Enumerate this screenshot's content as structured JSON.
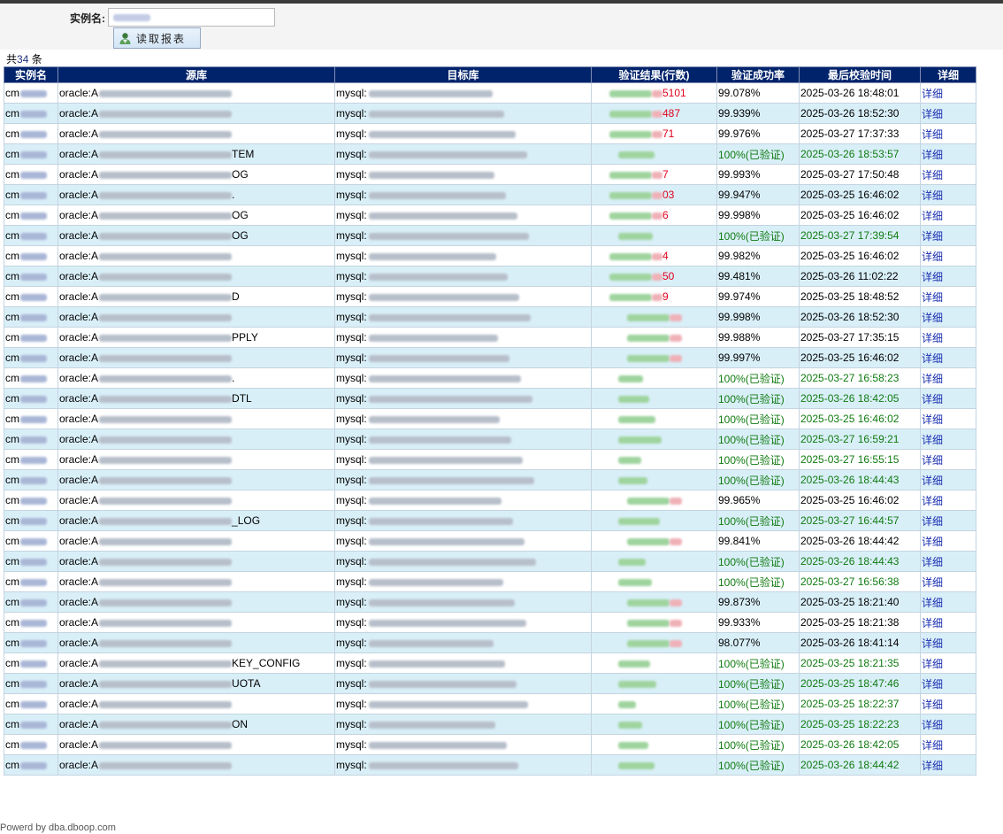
{
  "form": {
    "label": "实例名:",
    "input_value": "cmrkuar",
    "read_button": "读取报表"
  },
  "summary": {
    "prefix": "共",
    "count": "34",
    "suffix": " 条"
  },
  "table": {
    "headers": [
      "实例名",
      "源库",
      "目标库",
      "验证结果(行数)",
      "验证成功率",
      "最后校验时间",
      "详细"
    ],
    "rows": [
      {
        "inst": "cm",
        "src_pre": "oracle:A",
        "src_suf": "",
        "dst": "mysql:",
        "result_suf": "5101",
        "rate": "99.078%",
        "time": "2025-03-26 18:48:01",
        "ok": false
      },
      {
        "inst": "cm",
        "src_pre": "oracle:A",
        "src_suf": "",
        "dst": "mysql:",
        "result_suf": "487",
        "rate": "99.939%",
        "time": "2025-03-26 18:52:30",
        "ok": false
      },
      {
        "inst": "cm",
        "src_pre": "oracle:A",
        "src_suf": "",
        "dst": "mysql:",
        "result_suf": "71",
        "rate": "99.976%",
        "time": "2025-03-27 17:37:33",
        "ok": false
      },
      {
        "inst": "cm",
        "src_pre": "oracle:A",
        "src_suf": "TEM",
        "dst": "mysql:",
        "result_suf": "",
        "rate": "100%(已验证)",
        "time": "2025-03-26 18:53:57",
        "ok": true
      },
      {
        "inst": "cm",
        "src_pre": "oracle:A",
        "src_suf": "OG",
        "dst": "mysql:",
        "result_suf": "7",
        "rate": "99.993%",
        "time": "2025-03-27 17:50:48",
        "ok": false
      },
      {
        "inst": "cm",
        "src_pre": "oracle:A",
        "src_suf": ".",
        "dst": "mysql:",
        "result_suf": "03",
        "rate": "99.947%",
        "time": "2025-03-25 16:46:02",
        "ok": false
      },
      {
        "inst": "cm",
        "src_pre": "oracle:A",
        "src_suf": "OG",
        "dst": "mysql:",
        "result_suf": "6",
        "rate": "99.998%",
        "time": "2025-03-25 16:46:02",
        "ok": false
      },
      {
        "inst": "cm",
        "src_pre": "oracle:A",
        "src_suf": "OG",
        "dst": "mysql:",
        "result_suf": "",
        "rate": "100%(已验证)",
        "time": "2025-03-27 17:39:54",
        "ok": true
      },
      {
        "inst": "cm",
        "src_pre": "oracle:A",
        "src_suf": "",
        "dst": "mysql:",
        "result_suf": "4",
        "rate": "99.982%",
        "time": "2025-03-25 16:46:02",
        "ok": false
      },
      {
        "inst": "cm",
        "src_pre": "oracle:A",
        "src_suf": "",
        "dst": "mysql:",
        "result_suf": "50",
        "rate": "99.481%",
        "time": "2025-03-26 11:02:22",
        "ok": false
      },
      {
        "inst": "cm",
        "src_pre": "oracle:A",
        "src_suf": "D",
        "dst": "mysql:",
        "result_suf": "9",
        "rate": "99.974%",
        "time": "2025-03-25 18:48:52",
        "ok": false
      },
      {
        "inst": "cm",
        "src_pre": "oracle:A",
        "src_suf": "",
        "dst": "mysql:",
        "result_suf": "",
        "rate": "99.998%",
        "time": "2025-03-26 18:52:30",
        "ok": false
      },
      {
        "inst": "cm",
        "src_pre": "oracle:A",
        "src_suf": "PPLY",
        "dst": "mysql:",
        "result_suf": "",
        "rate": "99.988%",
        "time": "2025-03-27 17:35:15",
        "ok": false
      },
      {
        "inst": "cm",
        "src_pre": "oracle:A",
        "src_suf": "",
        "dst": "mysql:",
        "result_suf": "",
        "rate": "99.997%",
        "time": "2025-03-25 16:46:02",
        "ok": false
      },
      {
        "inst": "cm",
        "src_pre": "oracle:A",
        "src_suf": ".",
        "dst": "mysql:",
        "result_suf": "",
        "rate": "100%(已验证)",
        "time": "2025-03-27 16:58:23",
        "ok": true
      },
      {
        "inst": "cm",
        "src_pre": "oracle:A",
        "src_suf": "DTL",
        "dst": "mysql:",
        "result_suf": "",
        "rate": "100%(已验证)",
        "time": "2025-03-26 18:42:05",
        "ok": true
      },
      {
        "inst": "cm",
        "src_pre": "oracle:A",
        "src_suf": "",
        "dst": "mysql:",
        "result_suf": "",
        "rate": "100%(已验证)",
        "time": "2025-03-25 16:46:02",
        "ok": true
      },
      {
        "inst": "cm",
        "src_pre": "oracle:A",
        "src_suf": "",
        "dst": "mysql:",
        "result_suf": "",
        "rate": "100%(已验证)",
        "time": "2025-03-27 16:59:21",
        "ok": true
      },
      {
        "inst": "cm",
        "src_pre": "oracle:A",
        "src_suf": "",
        "dst": "mysql:",
        "result_suf": "",
        "rate": "100%(已验证)",
        "time": "2025-03-27 16:55:15",
        "ok": true
      },
      {
        "inst": "cm",
        "src_pre": "oracle:A",
        "src_suf": "",
        "dst": "mysql:",
        "result_suf": "",
        "rate": "100%(已验证)",
        "time": "2025-03-26 18:44:43",
        "ok": true
      },
      {
        "inst": "cm",
        "src_pre": "oracle:A",
        "src_suf": "",
        "dst": "mysql:",
        "result_suf": "",
        "rate": "99.965%",
        "time": "2025-03-25 16:46:02",
        "ok": false
      },
      {
        "inst": "cm",
        "src_pre": "oracle:A",
        "src_suf": "_LOG",
        "dst": "mysql:",
        "result_suf": "",
        "rate": "100%(已验证)",
        "time": "2025-03-27 16:44:57",
        "ok": true
      },
      {
        "inst": "cm",
        "src_pre": "oracle:A",
        "src_suf": "",
        "dst": "mysql:",
        "result_suf": "",
        "rate": "99.841%",
        "time": "2025-03-26 18:44:42",
        "ok": false
      },
      {
        "inst": "cm",
        "src_pre": "oracle:A",
        "src_suf": "",
        "dst": "mysql:",
        "result_suf": "",
        "rate": "100%(已验证)",
        "time": "2025-03-26 18:44:43",
        "ok": true
      },
      {
        "inst": "cm",
        "src_pre": "oracle:A",
        "src_suf": "",
        "dst": "mysql:",
        "result_suf": "",
        "rate": "100%(已验证)",
        "time": "2025-03-27 16:56:38",
        "ok": true
      },
      {
        "inst": "cm",
        "src_pre": "oracle:A",
        "src_suf": "",
        "dst": "mysql:",
        "result_suf": "",
        "rate": "99.873%",
        "time": "2025-03-25 18:21:40",
        "ok": false
      },
      {
        "inst": "cm",
        "src_pre": "oracle:A",
        "src_suf": "",
        "dst": "mysql:",
        "result_suf": "",
        "rate": "99.933%",
        "time": "2025-03-25 18:21:38",
        "ok": false
      },
      {
        "inst": "cm",
        "src_pre": "oracle:A",
        "src_suf": "",
        "dst": "mysql:",
        "result_suf": "",
        "rate": "98.077%",
        "time": "2025-03-26 18:41:14",
        "ok": false
      },
      {
        "inst": "cm",
        "src_pre": "oracle:A",
        "src_suf": "KEY_CONFIG",
        "dst": "mysql:",
        "result_suf": "",
        "rate": "100%(已验证)",
        "time": "2025-03-25 18:21:35",
        "ok": true
      },
      {
        "inst": "cm",
        "src_pre": "oracle:A",
        "src_suf": "UOTA",
        "dst": "mysql:",
        "result_suf": "",
        "rate": "100%(已验证)",
        "time": "2025-03-25 18:47:46",
        "ok": true
      },
      {
        "inst": "cm",
        "src_pre": "oracle:A",
        "src_suf": "",
        "dst": "mysql:",
        "result_suf": "",
        "rate": "100%(已验证)",
        "time": "2025-03-25 18:22:37",
        "ok": true
      },
      {
        "inst": "cm",
        "src_pre": "oracle:A",
        "src_suf": "ON",
        "dst": "mysql:",
        "result_suf": "",
        "rate": "100%(已验证)",
        "time": "2025-03-25 18:22:23",
        "ok": true
      },
      {
        "inst": "cm",
        "src_pre": "oracle:A",
        "src_suf": "",
        "dst": "mysql:",
        "result_suf": "",
        "rate": "100%(已验证)",
        "time": "2025-03-26 18:42:05",
        "ok": true
      },
      {
        "inst": "cm",
        "src_pre": "oracle:A",
        "src_suf": "",
        "dst": "mysql:",
        "result_suf": "",
        "rate": "100%(已验证)",
        "time": "2025-03-26 18:44:42",
        "ok": true
      }
    ],
    "detail_link": "详细"
  },
  "footer": "Powerd by dba.dboop.com",
  "colors": {
    "header_bg": "#00236b",
    "row_alt": "#d9eff8",
    "success": "#0f7a0f",
    "error": "#e0001b",
    "link": "#1a2fb0"
  },
  "icons": {
    "read_button": "user-icon"
  }
}
